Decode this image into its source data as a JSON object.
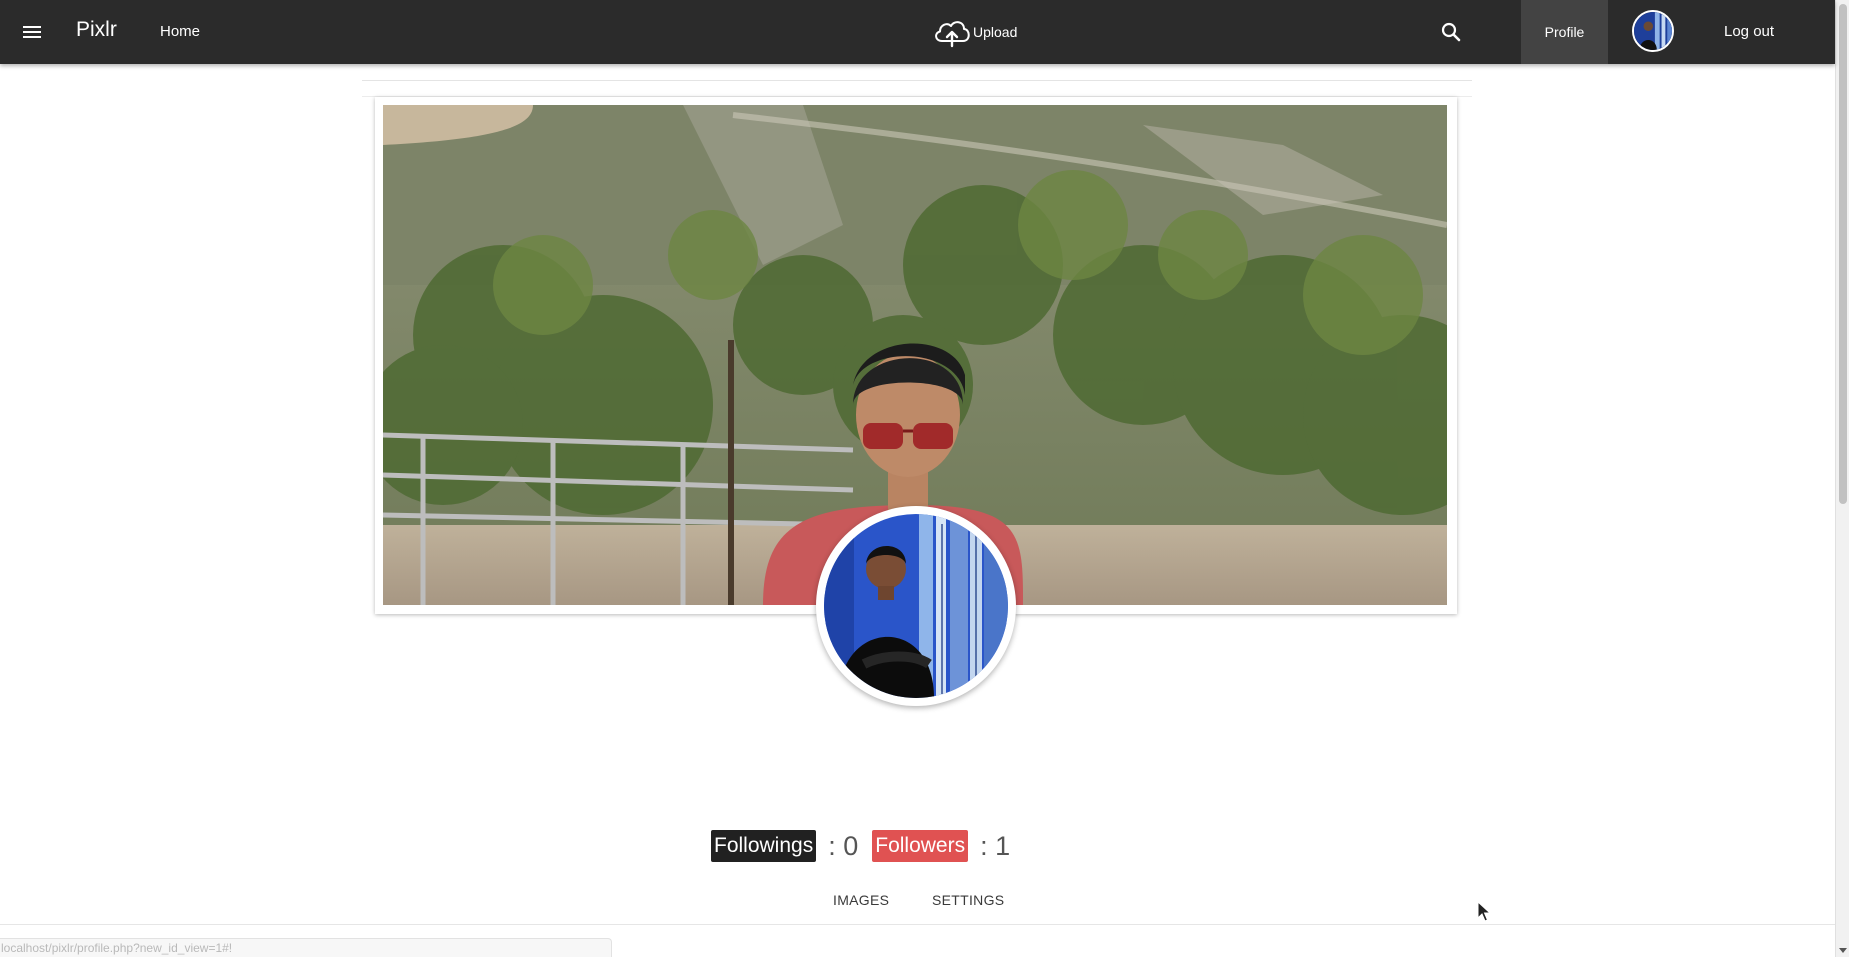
{
  "navbar": {
    "brand": "Pixlr",
    "home_label": "Home",
    "upload_label": "Upload",
    "profile_label": "Profile",
    "logout_label": "Log out",
    "icons": {
      "menu": "menu-icon",
      "upload": "cloud-upload-icon",
      "search": "search-icon"
    },
    "background_color": "#2b2b2b",
    "active_background_color": "#434343"
  },
  "stats": {
    "followings_label": "Followings",
    "followings_value": ": 0",
    "followers_label": "Followers",
    "followers_value": ": 1",
    "followings_color": "#212121",
    "followers_color": "#e05252"
  },
  "tabs": [
    {
      "label": "IMAGES"
    },
    {
      "label": "SETTINGS"
    }
  ],
  "status_bar": {
    "url": "localhost/pixlr/profile.php?new_id_view=1#!"
  }
}
